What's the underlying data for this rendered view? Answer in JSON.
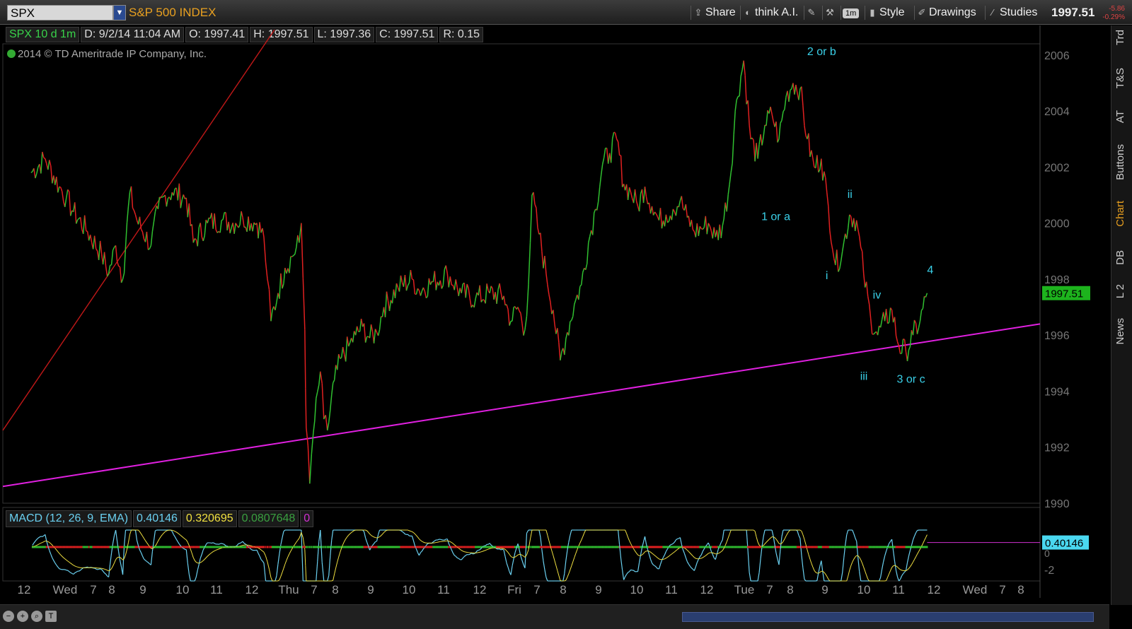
{
  "header": {
    "symbol": "SPX",
    "index_name": "S&P 500 INDEX",
    "buttons": [
      {
        "label": "Share",
        "icon": "share-icon"
      },
      {
        "label": "think A.I.",
        "icon": "ai-icon"
      },
      {
        "label": "",
        "icon": "drawing-tools-icon"
      },
      {
        "label": "",
        "icon": "wrench-icon"
      },
      {
        "label": "1m",
        "icon": "timeframe-badge"
      },
      {
        "label": "Style",
        "icon": "style-icon"
      },
      {
        "label": "Drawings",
        "icon": "pencil-icon"
      },
      {
        "label": "Studies",
        "icon": "studies-icon"
      }
    ],
    "last_price": "1997.51",
    "change": "-5.86",
    "change_pct": "-0.29%"
  },
  "info": {
    "symbol_span": "SPX 10 d 1m",
    "date": "D: 9/2/14 11:04 AM",
    "open": "O: 1997.41",
    "high": "H: 1997.51",
    "low": "L: 1997.36",
    "close": "C: 1997.51",
    "range": "R: 0.15"
  },
  "copyright": "2014 © TD Ameritrade IP Company, Inc.",
  "macd": {
    "label": "MACD (12, 26, 9, EMA)",
    "value": "0.40146",
    "avg": "0.320695",
    "diff": "0.0807648",
    "zero": "0",
    "last_tag": "0.40146",
    "axis_labels": [
      "0",
      "-2"
    ],
    "colors": {
      "value": "#6ad0f0",
      "avg": "#f0e040",
      "diff": "#3aa040",
      "zero": "#d030d0"
    }
  },
  "sidebar_tabs": [
    "Trd",
    "T&S",
    "AT",
    "Buttons",
    "Chart",
    "DB",
    "L 2",
    "News"
  ],
  "chart_data": {
    "type": "line",
    "price_axis": {
      "ticks": [
        1990,
        1992,
        1994,
        1996,
        1998,
        2000,
        2002,
        2004,
        2006
      ],
      "ylim": [
        1990,
        2006.4
      ]
    },
    "price_tag": "1997.51",
    "x_tick_labels": [
      "12",
      "Wed",
      "7",
      "8",
      "9",
      "10",
      "11",
      "12",
      "Thu",
      "7",
      "8",
      "9",
      "10",
      "11",
      "12",
      "Fri",
      "7",
      "8",
      "9",
      "10",
      "11",
      "12",
      "Tue",
      "7",
      "8",
      "9",
      "10",
      "11",
      "12",
      "Wed",
      "7",
      "8"
    ],
    "series": [
      {
        "name": "SPX 1m",
        "color_up": "#30c030",
        "color_down": "#e02020",
        "points": [
          [
            0,
            2001.8
          ],
          [
            2,
            2002.3
          ],
          [
            4,
            2001.3
          ],
          [
            5,
            2000.9
          ],
          [
            6,
            2000.4
          ],
          [
            8,
            1999.7
          ],
          [
            10,
            1998.9
          ],
          [
            11,
            1998.2
          ],
          [
            12,
            1999.2
          ],
          [
            13,
            1998.0
          ],
          [
            14,
            2001.1
          ],
          [
            15,
            2000.1
          ],
          [
            17,
            1999.2
          ],
          [
            18,
            2000.5
          ],
          [
            19,
            2001.0
          ],
          [
            20,
            2001.1
          ],
          [
            22,
            2000.9
          ],
          [
            23,
            1999.3
          ],
          [
            25,
            2000.0
          ],
          [
            27,
            2000.1
          ],
          [
            29,
            2000.0
          ],
          [
            30,
            2000.2
          ],
          [
            32,
            2000.0
          ],
          [
            33,
            1999.5
          ],
          [
            33.5,
            1998.0
          ],
          [
            34,
            1996.5
          ],
          [
            35,
            1997.5
          ],
          [
            36,
            1998.4
          ],
          [
            37,
            1998.8
          ],
          [
            38,
            1999.3
          ],
          [
            38.3,
            2000.0
          ],
          [
            38.8,
            1996.2
          ],
          [
            39,
            1992.7
          ],
          [
            39.5,
            1990.7
          ],
          [
            40,
            1992.5
          ],
          [
            41,
            1994.7
          ],
          [
            41.5,
            1993.0
          ],
          [
            42,
            1992.6
          ],
          [
            43,
            1994.4
          ],
          [
            44,
            1995.2
          ],
          [
            45,
            1995.6
          ],
          [
            46,
            1996.0
          ],
          [
            47,
            1996.3
          ],
          [
            48,
            1995.9
          ],
          [
            49,
            1996.1
          ],
          [
            50,
            1997.0
          ],
          [
            52,
            1997.7
          ],
          [
            54,
            1998.0
          ],
          [
            55,
            1997.6
          ],
          [
            57,
            1997.9
          ],
          [
            59,
            1998.2
          ],
          [
            61,
            1997.5
          ],
          [
            63,
            1997.3
          ],
          [
            65,
            1997.5
          ],
          [
            67,
            1997.4
          ],
          [
            68,
            1996.5
          ],
          [
            69,
            1997.0
          ],
          [
            70,
            1996.2
          ],
          [
            70.5,
            1997.8
          ],
          [
            71,
            2001.0
          ],
          [
            72,
            1999.6
          ],
          [
            73,
            1998.2
          ],
          [
            74,
            1996.9
          ],
          [
            75,
            1995.1
          ],
          [
            76,
            1996.1
          ],
          [
            77,
            1997.1
          ],
          [
            78,
            1997.8
          ],
          [
            79,
            1999.3
          ],
          [
            80,
            2000.5
          ],
          [
            81,
            2002.1
          ],
          [
            82,
            2002.5
          ],
          [
            83,
            2003.0
          ],
          [
            84,
            2001.4
          ],
          [
            85,
            2001.1
          ],
          [
            86,
            2000.6
          ],
          [
            87,
            2001.3
          ],
          [
            88,
            2000.6
          ],
          [
            89,
            2000.1
          ],
          [
            90,
            2000.3
          ],
          [
            91,
            2000.5
          ],
          [
            92,
            2000.8
          ],
          [
            93,
            2000.2
          ],
          [
            94,
            1999.7
          ],
          [
            95,
            1999.8
          ],
          [
            96,
            2000.0
          ],
          [
            97,
            1999.5
          ],
          [
            98,
            1999.9
          ],
          [
            99,
            2001.4
          ],
          [
            100,
            2004.4
          ],
          [
            101,
            2005.8
          ],
          [
            102,
            2003.0
          ],
          [
            103,
            2002.3
          ],
          [
            104,
            2003.5
          ],
          [
            105,
            2003.9
          ],
          [
            106,
            2003.0
          ],
          [
            107,
            2004.5
          ],
          [
            108,
            2005.0
          ],
          [
            109,
            2004.8
          ],
          [
            110,
            2003.0
          ],
          [
            111,
            2002.0
          ],
          [
            112,
            2002.3
          ],
          [
            113,
            2000.6
          ],
          [
            114,
            1998.5
          ],
          [
            115,
            1999.0
          ],
          [
            116,
            2000.3
          ],
          [
            117,
            2000.1
          ],
          [
            118,
            1998.2
          ],
          [
            119,
            1996.6
          ],
          [
            120,
            1996.0
          ],
          [
            121,
            1996.5
          ],
          [
            122,
            1996.9
          ],
          [
            123,
            1995.6
          ],
          [
            124,
            1995.4
          ],
          [
            125,
            1996.0
          ],
          [
            126,
            1996.5
          ],
          [
            127,
            1997.5
          ]
        ]
      }
    ],
    "trendlines": [
      {
        "name": "resistance",
        "color": "#c01818",
        "from": [
          -4,
          1992.6
        ],
        "to": [
          34.5,
          2006.9
        ]
      },
      {
        "name": "support",
        "color": "#e020e0",
        "from": [
          -4,
          1990.6
        ],
        "to": [
          143,
          1996.4
        ]
      }
    ],
    "annotations": [
      {
        "text": "2 or b",
        "x": 110,
        "y": 2006.0
      },
      {
        "text": "1 or a",
        "x": 103.5,
        "y": 2000.1
      },
      {
        "text": "ii",
        "x": 115.7,
        "y": 2000.9
      },
      {
        "text": "i",
        "x": 112.6,
        "y": 1998.0
      },
      {
        "text": "iv",
        "x": 119.3,
        "y": 1997.3
      },
      {
        "text": "4",
        "x": 127,
        "y": 1998.2
      },
      {
        "text": "iii",
        "x": 117.5,
        "y": 1994.4
      },
      {
        "text": "3 or c",
        "x": 122.7,
        "y": 1994.3
      }
    ]
  }
}
